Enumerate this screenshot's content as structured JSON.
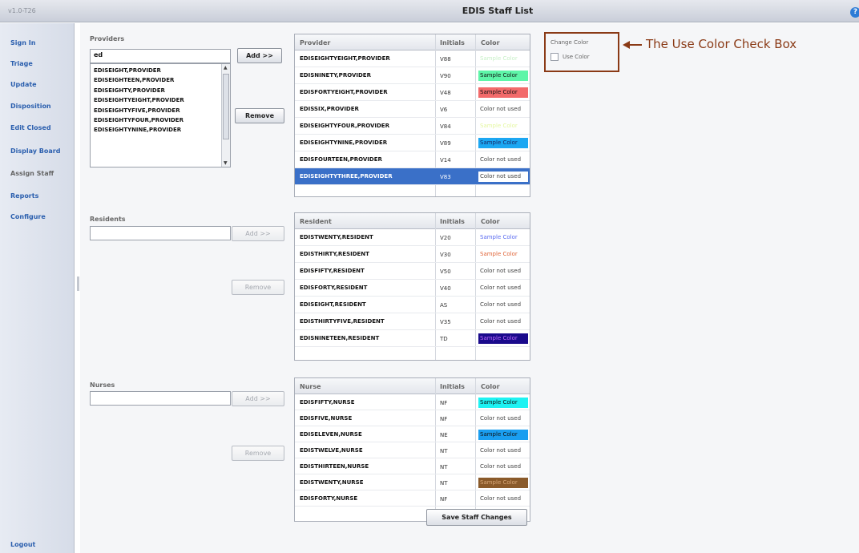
{
  "app": {
    "version": "v1.0-T26",
    "title": "EDIS Staff List",
    "help_icon": "help-icon"
  },
  "sidebar": {
    "items": [
      {
        "label": "Sign In"
      },
      {
        "label": "Triage"
      },
      {
        "label": "Update"
      },
      {
        "label": "Disposition"
      },
      {
        "label": "Edit Closed"
      },
      {
        "label": "Display Board"
      },
      {
        "label": "Assign Staff",
        "current": true
      },
      {
        "label": "Reports"
      },
      {
        "label": "Configure"
      }
    ],
    "logout": "Logout"
  },
  "providers": {
    "label": "Providers",
    "search_value": "ed",
    "add_button": "Add >>",
    "remove_button": "Remove",
    "list": [
      "EDISEIGHT,PROVIDER",
      "EDISEIGHTEEN,PROVIDER",
      "EDISEIGHTY,PROVIDER",
      "EDISEIGHTYEIGHT,PROVIDER",
      "EDISEIGHTYFIVE,PROVIDER",
      "EDISEIGHTYFOUR,PROVIDER",
      "EDISEIGHTYNINE,PROVIDER"
    ],
    "table": {
      "headers": [
        "Provider",
        "Initials",
        "Color"
      ],
      "rows": [
        {
          "name": "EDISEIGHTYEIGHT,PROVIDER",
          "initials": "V88",
          "color_text": "Sample Color",
          "fg": "#c8f0c8",
          "bg": "#ffffff"
        },
        {
          "name": "EDISNINETY,PROVIDER",
          "initials": "V90",
          "color_text": "Sample Color",
          "fg": "#111111",
          "bg": "#5ef5a8"
        },
        {
          "name": "EDISFORTYEIGHT,PROVIDER",
          "initials": "V48",
          "color_text": "Sample Color",
          "fg": "#111111",
          "bg": "#f26a6a"
        },
        {
          "name": "EDISSIX,PROVIDER",
          "initials": "V6",
          "color_text": "Color not used",
          "fg": "#444444",
          "bg": "#ffffff"
        },
        {
          "name": "EDISEIGHTYFOUR,PROVIDER",
          "initials": "V84",
          "color_text": "Sample Color",
          "fg": "#e4f7a0",
          "bg": "#ffffff"
        },
        {
          "name": "EDISEIGHTYNINE,PROVIDER",
          "initials": "V89",
          "color_text": "Sample Color",
          "fg": "#1a2a66",
          "bg": "#1ca7f2"
        },
        {
          "name": "EDISFOURTEEN,PROVIDER",
          "initials": "V14",
          "color_text": "Color not used",
          "fg": "#444444",
          "bg": "#ffffff"
        },
        {
          "name": "EDISEIGHTYTHREE,PROVIDER",
          "initials": "V83",
          "color_text": "Color not used",
          "fg": "#444444",
          "bg": "#ffffff",
          "selected": true
        }
      ]
    }
  },
  "residents": {
    "label": "Residents",
    "search_value": "",
    "add_button": "Add >>",
    "remove_button": "Remove",
    "table": {
      "headers": [
        "Resident",
        "Initials",
        "Color"
      ],
      "rows": [
        {
          "name": "EDISTWENTY,RESIDENT",
          "initials": "V20",
          "color_text": "Sample Color",
          "fg": "#5b6cf0",
          "bg": "#ffffff"
        },
        {
          "name": "EDISTHIRTY,RESIDENT",
          "initials": "V30",
          "color_text": "Sample Color",
          "fg": "#e0663a",
          "bg": "#ffffff"
        },
        {
          "name": "EDISFIFTY,RESIDENT",
          "initials": "V50",
          "color_text": "Color not used",
          "fg": "#444444",
          "bg": "#ffffff"
        },
        {
          "name": "EDISFORTY,RESIDENT",
          "initials": "V40",
          "color_text": "Color not used",
          "fg": "#444444",
          "bg": "#ffffff"
        },
        {
          "name": "EDISEIGHT,RESIDENT",
          "initials": "AS",
          "color_text": "Color not used",
          "fg": "#444444",
          "bg": "#ffffff"
        },
        {
          "name": "EDISTHIRTYFIVE,RESIDENT",
          "initials": "V35",
          "color_text": "Color not used",
          "fg": "#444444",
          "bg": "#ffffff"
        },
        {
          "name": "EDISNINETEEN,RESIDENT",
          "initials": "TD",
          "color_text": "Sample Color",
          "fg": "#c06aff",
          "bg": "#1a0a8c"
        }
      ]
    }
  },
  "nurses": {
    "label": "Nurses",
    "search_value": "",
    "add_button": "Add >>",
    "remove_button": "Remove",
    "table": {
      "headers": [
        "Nurse",
        "Initials",
        "Color"
      ],
      "rows": [
        {
          "name": "EDISFIFTY,NURSE",
          "initials": "NF",
          "color_text": "Sample Color",
          "fg": "#111111",
          "bg": "#1ef2f2"
        },
        {
          "name": "EDISFIVE,NURSE",
          "initials": "NF",
          "color_text": "Color not used",
          "fg": "#444444",
          "bg": "#ffffff"
        },
        {
          "name": "EDISELEVEN,NURSE",
          "initials": "NE",
          "color_text": "Sample Color",
          "fg": "#111111",
          "bg": "#1a9ef0"
        },
        {
          "name": "EDISTWELVE,NURSE",
          "initials": "NT",
          "color_text": "Color not used",
          "fg": "#444444",
          "bg": "#ffffff"
        },
        {
          "name": "EDISTHIRTEEN,NURSE",
          "initials": "NT",
          "color_text": "Color not used",
          "fg": "#444444",
          "bg": "#ffffff"
        },
        {
          "name": "EDISTWENTY,NURSE",
          "initials": "NT",
          "color_text": "Sample Color",
          "fg": "#d8a878",
          "bg": "#8a5a2a"
        },
        {
          "name": "EDISFORTY,NURSE",
          "initials": "NF",
          "color_text": "Color not used",
          "fg": "#444444",
          "bg": "#ffffff"
        }
      ]
    }
  },
  "change_color": {
    "title": "Change Color",
    "checkbox_label": "Use Color",
    "checked": false
  },
  "callout": "The Use Color Check Box",
  "save_button": "Save Staff Changes"
}
